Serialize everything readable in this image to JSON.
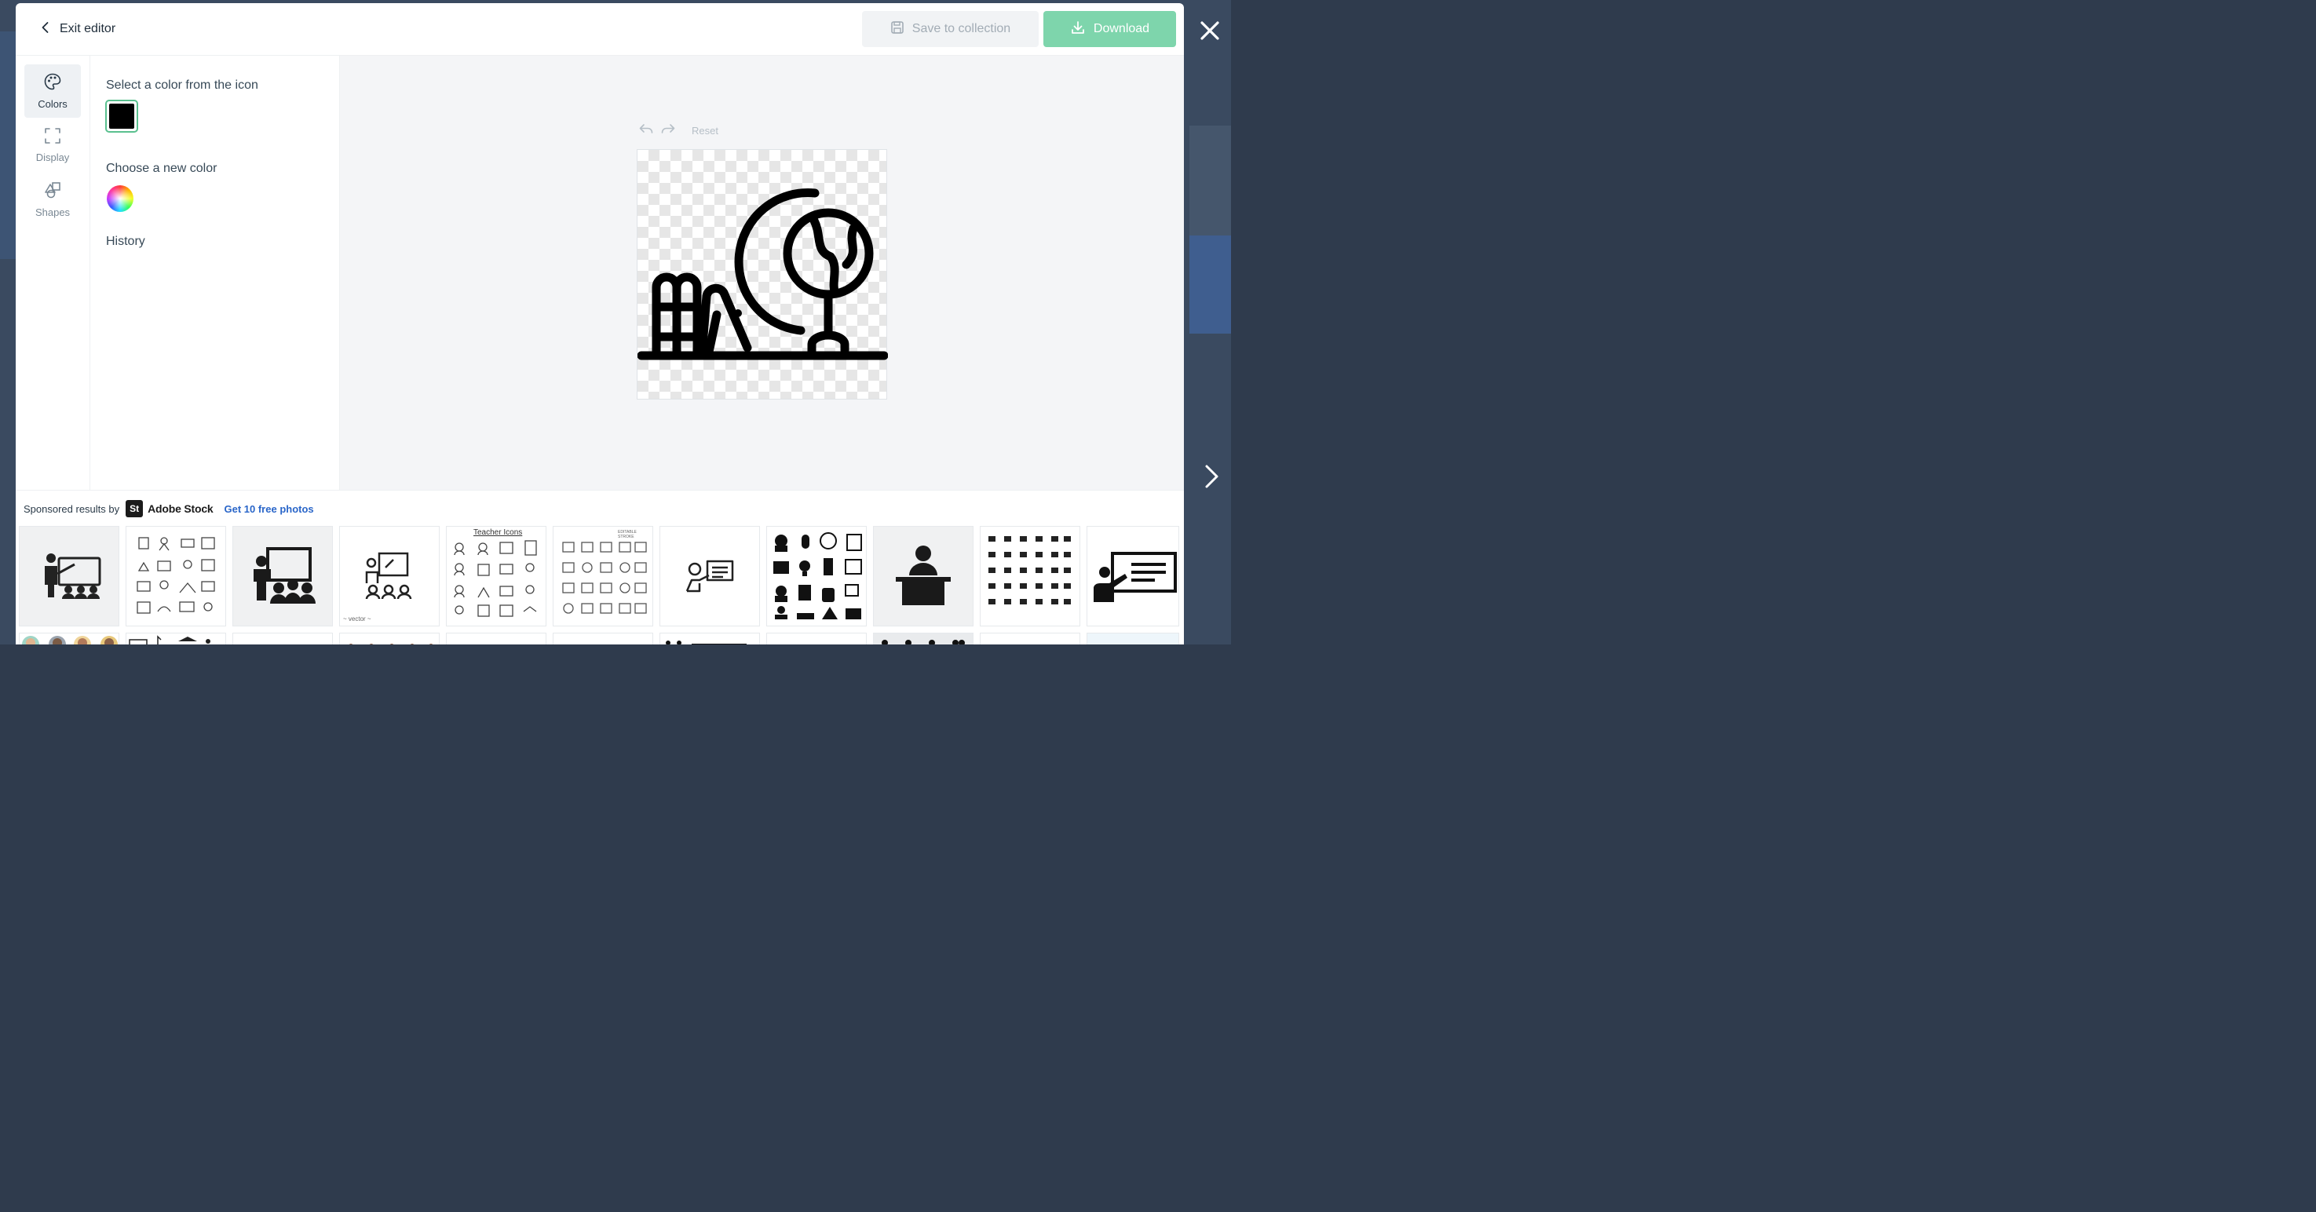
{
  "header": {
    "exit_label": "Exit editor",
    "save_label": "Save to collection",
    "download_label": "Download"
  },
  "rail": {
    "items": [
      {
        "label": "Colors",
        "active": true
      },
      {
        "label": "Display",
        "active": false
      },
      {
        "label": "Shapes",
        "active": false
      }
    ]
  },
  "panel": {
    "select_title": "Select a color from the icon",
    "selected_color": "#000000",
    "choose_title": "Choose a new color",
    "history_title": "History"
  },
  "canvas": {
    "reset_label": "Reset",
    "icon_name": "bookshelf-globe-icon",
    "icon_color": "#000000"
  },
  "sponsored": {
    "prefix": "Sponsored results by",
    "badge": "St",
    "brand": "Adobe Stock",
    "link": "Get 10 free photos",
    "thumbs": [
      {
        "name": "teacher-board-audience-thumb",
        "caption": ""
      },
      {
        "name": "teacher-line-icons-grid-thumb",
        "caption": ""
      },
      {
        "name": "teacher-presentation-class-thumb",
        "caption": ""
      },
      {
        "name": "teacher-outline-board-thumb",
        "caption": "~ vector ~"
      },
      {
        "name": "teacher-icons-set-thumb",
        "caption": "Teacher Icons"
      },
      {
        "name": "editable-stroke-icons-thumb",
        "caption": "EDITABLE STROKE"
      },
      {
        "name": "teacher-pointing-board-thumb",
        "caption": ""
      },
      {
        "name": "education-icons-grid-thumb",
        "caption": ""
      },
      {
        "name": "teacher-at-desk-thumb",
        "caption": ""
      },
      {
        "name": "school-icons-grid-thumb",
        "caption": ""
      },
      {
        "name": "teacher-whiteboard-thumb",
        "caption": ""
      }
    ]
  },
  "colors": {
    "accent_green": "#7ed5ac",
    "selected_border": "#5ac08f",
    "link_blue": "#2a66c9"
  }
}
